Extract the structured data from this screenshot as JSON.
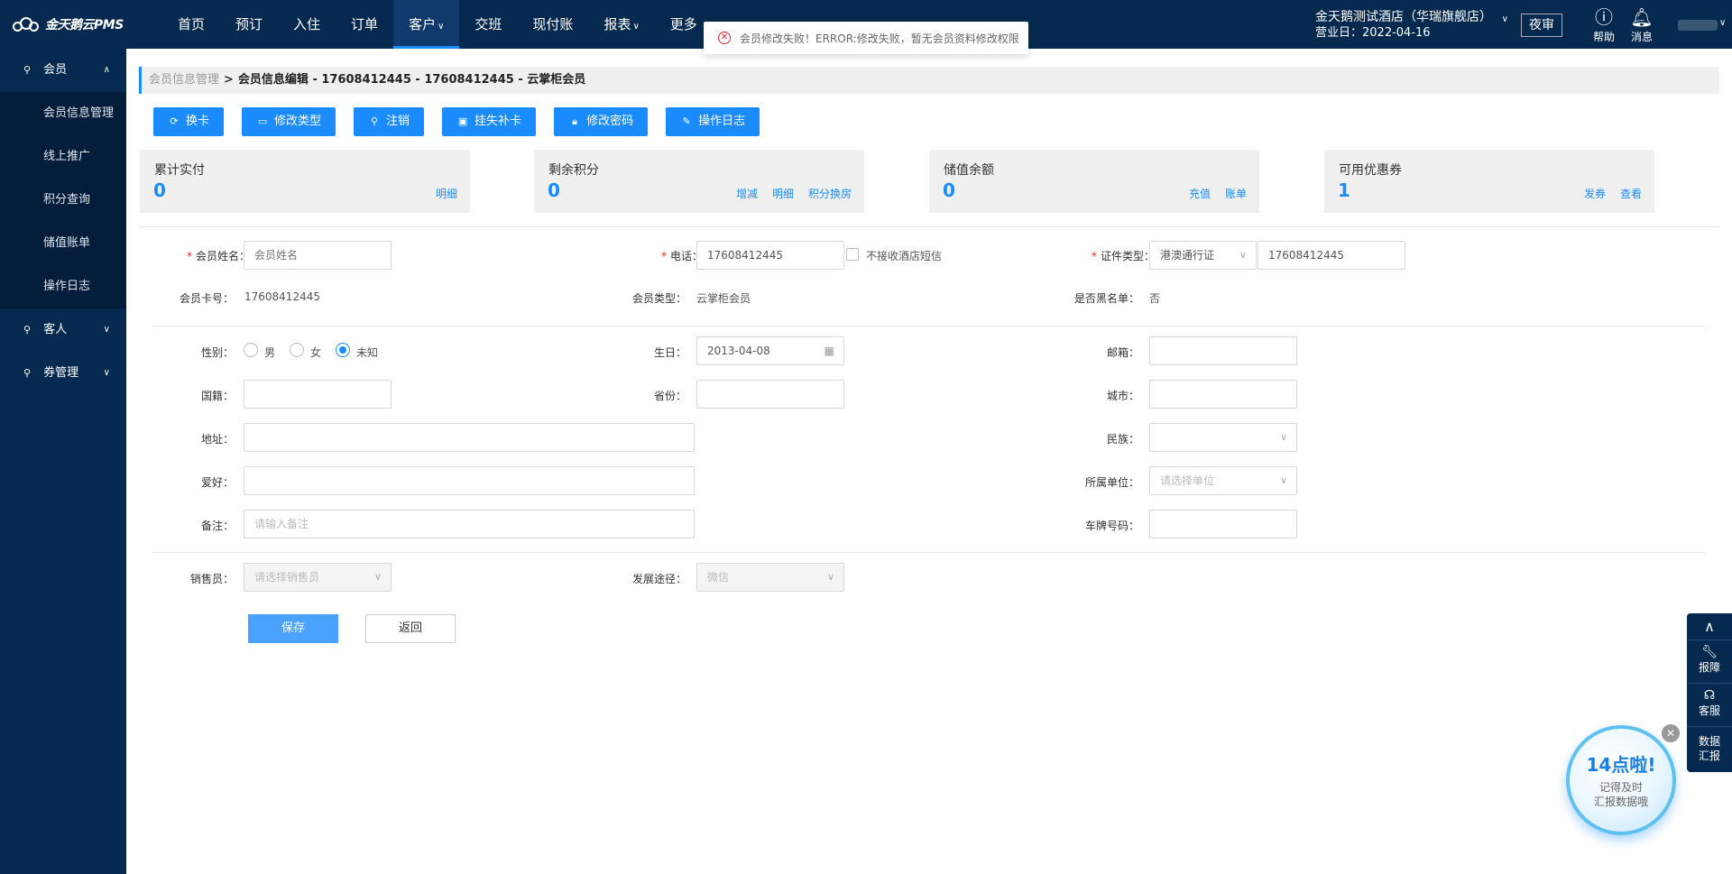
{
  "app": {
    "logo_text": "金天鹅云PMS"
  },
  "nav": {
    "items": [
      {
        "label": "首页"
      },
      {
        "label": "预订"
      },
      {
        "label": "入住"
      },
      {
        "label": "订单"
      },
      {
        "label": "客户",
        "active": true,
        "caret": "∨"
      },
      {
        "label": "交班"
      },
      {
        "label": "现付账"
      },
      {
        "label": "报表",
        "caret": "∨"
      },
      {
        "label": "更多"
      }
    ]
  },
  "header": {
    "hotel_name": "金天鹅测试酒店（华瑞旗舰店）",
    "business_date": "营业日：2022-04-16",
    "night_audit": "夜审",
    "help": "帮助",
    "messages": "消息"
  },
  "toast": {
    "message": "会员修改失败！ERROR:修改失败，暂无会员资料修改权限"
  },
  "sidebar": {
    "groups": [
      {
        "label": "会员",
        "expanded": true,
        "items": [
          "会员信息管理",
          "线上推广",
          "积分查询",
          "储值账单",
          "操作日志"
        ]
      },
      {
        "label": "客人",
        "expanded": false
      },
      {
        "label": "券管理",
        "expanded": false
      }
    ]
  },
  "breadcrumb": {
    "parent": "会员信息管理",
    "sep": ">",
    "current": "会员信息编辑 - 17608412445 - 17608412445 - 云掌柜会员"
  },
  "actions": [
    "换卡",
    "修改类型",
    "注销",
    "挂失补卡",
    "修改密码",
    "操作日志"
  ],
  "stats": [
    {
      "label": "累计实付",
      "value": "0",
      "links": [
        "明细"
      ]
    },
    {
      "label": "剩余积分",
      "value": "0",
      "links": [
        "增减",
        "明细",
        "积分换房"
      ]
    },
    {
      "label": "储值余额",
      "value": "0",
      "links": [
        "充值",
        "账单"
      ]
    },
    {
      "label": "可用优惠券",
      "value": "1",
      "links": [
        "发券",
        "查看"
      ]
    }
  ],
  "form": {
    "name_label": "会员姓名：",
    "name_placeholder": "会员姓名",
    "phone_label": "电话：",
    "phone_value": "17608412445",
    "sms_opt_out": "不接收酒店短信",
    "id_type_label": "证件类型：",
    "id_type_value": "港澳通行证",
    "id_number": "17608412445",
    "card_no_label": "会员卡号：",
    "card_no_value": "17608412445",
    "member_type_label": "会员类型：",
    "member_type_value": "云掌柜会员",
    "blacklist_label": "是否黑名单：",
    "blacklist_value": "否",
    "gender_label": "性别：",
    "gender_options": [
      "男",
      "女",
      "未知"
    ],
    "gender_selected": "未知",
    "birthday_label": "生日：",
    "birthday_value": "2013-04-08",
    "email_label": "邮箱：",
    "nationality_label": "国籍：",
    "province_label": "省份：",
    "city_label": "城市：",
    "address_label": "地址：",
    "ethnicity_label": "民族：",
    "hobby_label": "爱好：",
    "company_label": "所属单位：",
    "company_placeholder": "请选择单位",
    "remark_label": "备注：",
    "remark_placeholder": "请输入备注",
    "plate_label": "车牌号码：",
    "sales_label": "销售员：",
    "sales_placeholder": "请选择销售员",
    "channel_label": "发展途径：",
    "channel_value": "微信",
    "save": "保存",
    "back": "返回"
  },
  "float_panel": {
    "items": [
      "报障",
      "客服",
      "数据汇报"
    ]
  },
  "reminder": {
    "title": "14点啦!",
    "line1": "记得及时",
    "line2": "汇报数据哦"
  }
}
